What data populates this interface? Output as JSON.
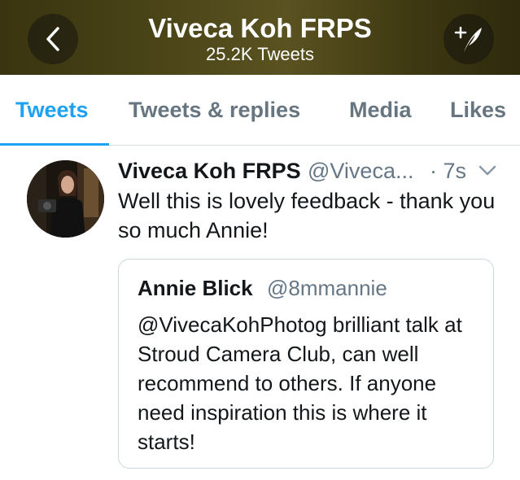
{
  "header": {
    "title": "Viveca Koh FRPS",
    "subtitle": "25.2K Tweets",
    "back_icon": "chevron-left-icon",
    "compose_icon": "compose-tweet-icon",
    "background_color": "#4a4418"
  },
  "tabs": [
    {
      "label": "Tweets",
      "active": true
    },
    {
      "label": "Tweets & replies",
      "active": false
    },
    {
      "label": "Media",
      "active": false
    },
    {
      "label": "Likes",
      "active": false
    }
  ],
  "accent_color": "#1da1f2",
  "tweet": {
    "author_name": "Viveca Koh FRPS",
    "author_handle": "@Viveca...",
    "time": "· 7s",
    "text": "Well this is lovely feedback - thank you so much Annie!",
    "menu_icon": "chevron-down-icon",
    "quoted": {
      "author_name": "Annie Blick",
      "author_handle": "@8mmannie",
      "text": "@VivecaKohPhotog brilliant talk at Stroud Camera Club, can well recommend to others. If anyone need inspiration this is where it starts!"
    }
  }
}
